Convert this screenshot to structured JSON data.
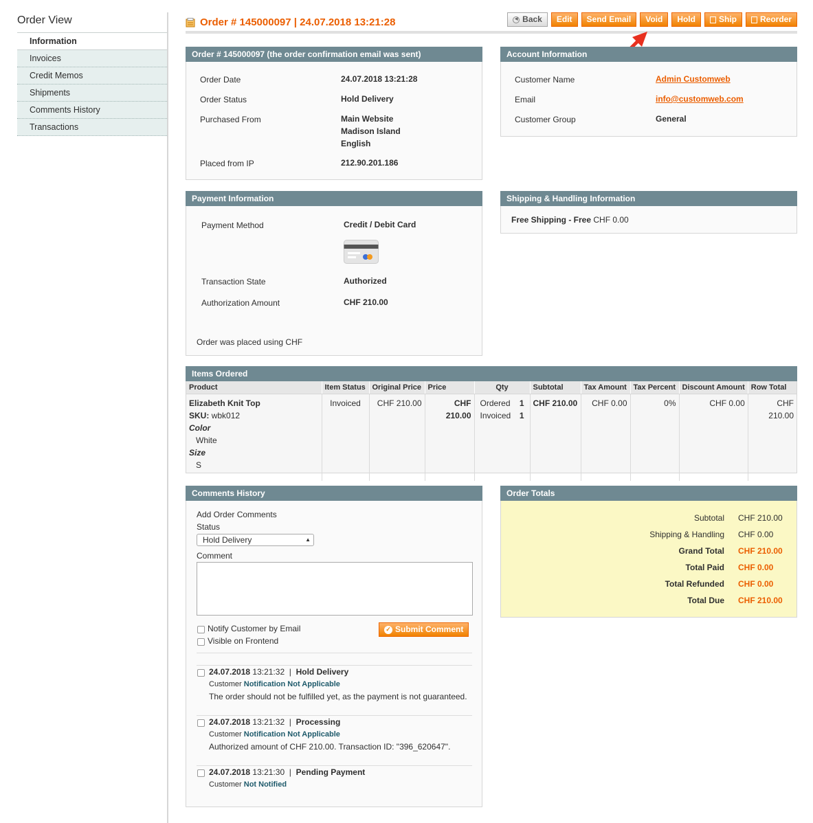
{
  "sidebar": {
    "title": "Order View",
    "items": [
      "Information",
      "Invoices",
      "Credit Memos",
      "Shipments",
      "Comments History",
      "Transactions"
    ]
  },
  "header": {
    "title": "Order # 145000097 | 24.07.2018 13:21:28",
    "buttons": {
      "back": "Back",
      "edit": "Edit",
      "send_email": "Send Email",
      "void": "Void",
      "hold": "Hold",
      "ship": "Ship",
      "reorder": "Reorder"
    }
  },
  "order_box": {
    "head": "Order # 145000097 (the order confirmation email was sent)",
    "order_date_label": "Order Date",
    "order_date": "24.07.2018 13:21:28",
    "status_label": "Order Status",
    "status": "Hold Delivery",
    "purchased_label": "Purchased From",
    "purchased_1": "Main Website",
    "purchased_2": "Madison Island",
    "purchased_3": "English",
    "ip_label": "Placed from IP",
    "ip": "212.90.201.186"
  },
  "account_box": {
    "head": "Account Information",
    "name_label": "Customer Name",
    "name": "Admin Customweb",
    "email_label": "Email",
    "email": "info@customweb.com",
    "group_label": "Customer Group",
    "group": "General"
  },
  "payment_box": {
    "head": "Payment Information",
    "method_label": "Payment Method",
    "method": "Credit / Debit Card",
    "state_label": "Transaction State",
    "state": "Authorized",
    "amount_label": "Authorization Amount",
    "amount": "CHF 210.00",
    "note": "Order was placed using CHF"
  },
  "shipping_box": {
    "head": "Shipping & Handling Information",
    "method": "Free Shipping - Free",
    "price": "CHF 0.00"
  },
  "items": {
    "head": "Items Ordered",
    "columns": [
      "Product",
      "Item Status",
      "Original Price",
      "Price",
      "Qty",
      "Subtotal",
      "Tax Amount",
      "Tax Percent",
      "Discount Amount",
      "Row Total"
    ],
    "row": {
      "name": "Elizabeth Knit Top",
      "sku_label": "SKU:",
      "sku": "wbk012",
      "opt1_label": "Color",
      "opt1": "White",
      "opt2_label": "Size",
      "opt2": "S",
      "status": "Invoiced",
      "original_price": "CHF 210.00",
      "price": "CHF 210.00",
      "qty_ordered_label": "Ordered",
      "qty_ordered": "1",
      "qty_invoiced_label": "Invoiced",
      "qty_invoiced": "1",
      "subtotal": "CHF 210.00",
      "tax_amount": "CHF 0.00",
      "tax_percent": "0%",
      "discount": "CHF 0.00",
      "row_total": "CHF 210.00"
    }
  },
  "comments": {
    "head": "Comments History",
    "add_label": "Add Order Comments",
    "status_label": "Status",
    "status_value": "Hold Delivery",
    "comment_label": "Comment",
    "notify_label": "Notify Customer by Email",
    "visible_label": "Visible on Frontend",
    "submit": "Submit Comment",
    "history": [
      {
        "date": "24.07.2018",
        "time": "13:21:32",
        "status": "Hold Delivery",
        "customer": "Customer",
        "notification": "Notification Not Applicable",
        "text": "The order should not be fulfilled yet, as the payment is not guaranteed."
      },
      {
        "date": "24.07.2018",
        "time": "13:21:32",
        "status": "Processing",
        "customer": "Customer",
        "notification": "Notification Not Applicable",
        "text": "Authorized amount of CHF 210.00. Transaction ID: \"396_620647\"."
      },
      {
        "date": "24.07.2018",
        "time": "13:21:30",
        "status": "Pending Payment",
        "customer": "Customer",
        "notification": "Not Notified",
        "text": ""
      }
    ]
  },
  "totals": {
    "head": "Order Totals",
    "rows": [
      {
        "label": "Subtotal",
        "value": "CHF 210.00"
      },
      {
        "label": "Shipping & Handling",
        "value": "CHF 0.00"
      },
      {
        "label": "Grand Total",
        "value": "CHF 210.00"
      },
      {
        "label": "Total Paid",
        "value": "CHF 0.00"
      },
      {
        "label": "Total Refunded",
        "value": "CHF 0.00"
      },
      {
        "label": "Total Due",
        "value": "CHF 210.00"
      }
    ]
  },
  "colors": {
    "accent": "#eb5e00",
    "box_head": "#6f8992",
    "totals_bg": "#fbf8c5",
    "annotation_arrow": "#e8301f"
  }
}
